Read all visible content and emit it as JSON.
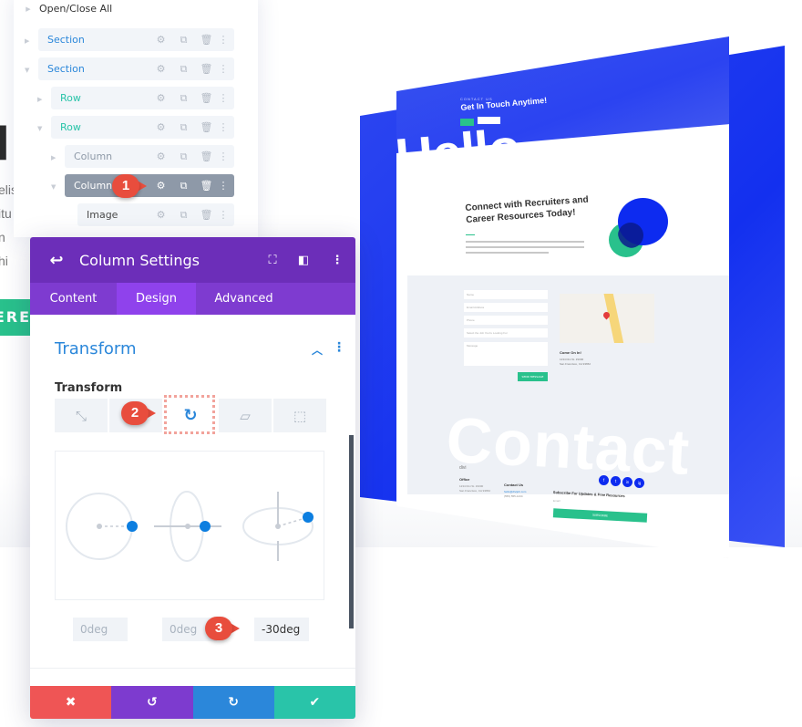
{
  "background_page": {
    "heading_fragment": "l",
    "text_lines": [
      "elis",
      "itu",
      "n",
      "hi"
    ],
    "cta_fragment": "ERE",
    "cta_color": "#29c18c"
  },
  "layers_panel": {
    "open_close_label": "Open/Close All",
    "rows": [
      {
        "label": "Section",
        "type": "section",
        "expanded": false,
        "selected": false
      },
      {
        "label": "Section",
        "type": "section",
        "expanded": true,
        "selected": false
      },
      {
        "label": "Row",
        "type": "row",
        "expanded": false,
        "selected": false
      },
      {
        "label": "Row",
        "type": "row",
        "expanded": true,
        "selected": false
      },
      {
        "label": "Column",
        "type": "column",
        "expanded": false,
        "selected": false
      },
      {
        "label": "Column",
        "type": "column",
        "expanded": true,
        "selected": true
      },
      {
        "label": "Image",
        "type": "module",
        "expanded": false,
        "selected": false
      }
    ],
    "row_actions": [
      "gear-icon",
      "duplicate-icon",
      "trash-icon",
      "more-icon"
    ]
  },
  "annotations": [
    {
      "number": "1",
      "target": "column-settings-gear"
    },
    {
      "number": "2",
      "target": "rotate-tab"
    },
    {
      "number": "3",
      "target": "rotate-z-input"
    }
  ],
  "settings_modal": {
    "title": "Column Settings",
    "header_icons": [
      "back-icon",
      "expand-icon",
      "sidebar-layout-icon",
      "more-icon"
    ],
    "tabs": [
      {
        "label": "Content",
        "active": false
      },
      {
        "label": "Design",
        "active": true
      },
      {
        "label": "Advanced",
        "active": false
      }
    ],
    "section_title": "Transform",
    "option_label": "Transform",
    "transform_tabs": [
      {
        "name": "scale",
        "icon": "scale-arrows-icon",
        "active": false
      },
      {
        "name": "translate",
        "icon": "move-icon",
        "active": false
      },
      {
        "name": "rotate",
        "icon": "rotate-icon",
        "active": true
      },
      {
        "name": "skew",
        "icon": "skew-icon",
        "active": false
      },
      {
        "name": "origin",
        "icon": "origin-icon",
        "active": false
      }
    ],
    "rotate_inputs": [
      {
        "axis": "x",
        "value": "0deg"
      },
      {
        "axis": "y",
        "value": "0deg"
      },
      {
        "axis": "z",
        "value": "-30deg"
      }
    ],
    "footer_buttons": [
      {
        "name": "cancel",
        "glyph": "✖",
        "color": "#ef5555"
      },
      {
        "name": "undo",
        "glyph": "↺",
        "color": "#7d3bcf"
      },
      {
        "name": "redo",
        "glyph": "↻",
        "color": "#2b87da"
      },
      {
        "name": "save",
        "glyph": "✔",
        "color": "#29c4a9"
      }
    ]
  },
  "preview": {
    "hero_kicker": "CONTACT US",
    "hero_title": "Get In Touch Anytime!",
    "hero_big_word": "Hello",
    "connect_title": "Connect with Recruiters and Career Resources Today!",
    "form_fields": [
      "Name",
      "Email Address",
      "Phone",
      "Select the Job You're Looking For",
      "Message"
    ],
    "send_button": "SEND MESSAGE",
    "location_title": "Come On In!",
    "location_lines": [
      "1234 Divi St. #1000",
      "San Francisco, CA 93652"
    ],
    "contact_big_word": "Contact",
    "footer": {
      "logo": "divi",
      "office_title": "Office",
      "office_lines": [
        "1234 Divi St. #1000",
        "San Francisco, CA 93652"
      ],
      "contact_title": "Contact Us",
      "contact_lines": [
        "hello@divijob.com",
        "(555) 555-1234"
      ],
      "subscribe_title": "Subscribe For Updates & Free Resources",
      "subscribe_placeholder": "Email",
      "subscribe_button": "SUBSCRIBE",
      "social_icons": [
        "f",
        "t",
        "in",
        "ig"
      ]
    },
    "brand_blue": "#1330ef",
    "brand_green": "#29c18c"
  }
}
